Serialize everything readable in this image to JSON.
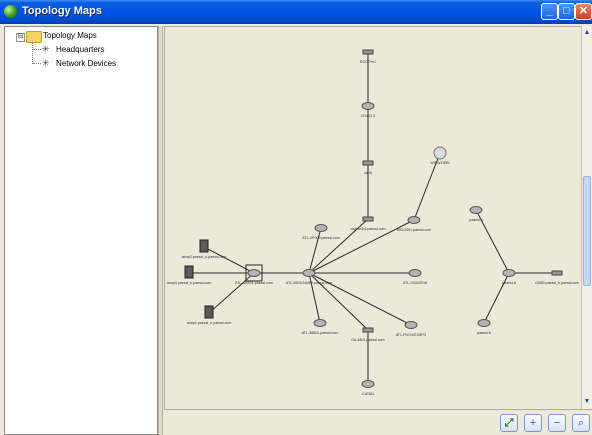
{
  "window": {
    "title": "Topology Maps"
  },
  "tree": {
    "expand_glyph": "⊟",
    "root_label": "Topology Maps",
    "items": [
      {
        "label": "Headquarters",
        "icon": "network-node-icon"
      },
      {
        "label": "Network Devices",
        "icon": "network-node-icon"
      }
    ]
  },
  "map": {
    "nodes": [
      {
        "id": "top",
        "label": "ROOT%C",
        "type": "hub"
      },
      {
        "id": "n2",
        "label": "CISCO 3",
        "type": "router"
      },
      {
        "id": "n3",
        "label": "cap5",
        "type": "hub"
      },
      {
        "id": "n4",
        "label": "wsmor3r3.paessl.com",
        "type": "hub"
      },
      {
        "id": "n5",
        "label": "EB103N1.paessl.com",
        "type": "router"
      },
      {
        "id": "globe",
        "label": "WWW.DEBI",
        "type": "globe"
      },
      {
        "id": "c1",
        "label": "ATL-VP009.paessl.com",
        "type": "router"
      },
      {
        "id": "center",
        "label": "ATL-6903/24MNI.paessl.com",
        "type": "router"
      },
      {
        "id": "sw",
        "label": "ATL-AX8S1.paessl.com",
        "type": "switch"
      },
      {
        "id": "l1",
        "label": "atrap2.paessl_n.paessl.com",
        "type": "server"
      },
      {
        "id": "l2",
        "label": "atrap3.paessl_n.paessl.com",
        "type": "server"
      },
      {
        "id": "l3",
        "label": "atrap1.paessl_n.paessl.com",
        "type": "server"
      },
      {
        "id": "r1",
        "label": "ATL-X04X/EH8",
        "type": "router"
      },
      {
        "id": "r2",
        "label": "ATL-PHOX/EX8PG",
        "type": "router"
      },
      {
        "id": "b1",
        "label": "ATL-38800.paessl.com",
        "type": "router"
      },
      {
        "id": "b2",
        "label": "DA-4801.paessl.com",
        "type": "hub"
      },
      {
        "id": "b3",
        "label": "CATAN",
        "type": "router"
      },
      {
        "id": "g1",
        "label": "paaesl-k",
        "type": "router"
      },
      {
        "id": "g2",
        "label": "paaesl-8",
        "type": "router"
      },
      {
        "id": "g3",
        "label": "paaesl-6",
        "type": "router"
      },
      {
        "id": "g4",
        "label": "c3550.paessl_n.paessl.com",
        "type": "hub"
      }
    ],
    "links": [
      [
        "top",
        "n2"
      ],
      [
        "n2",
        "n3"
      ],
      [
        "n3",
        "n4"
      ],
      [
        "n4",
        "center"
      ],
      [
        "globe",
        "n5"
      ],
      [
        "n5",
        "center"
      ],
      [
        "c1",
        "center"
      ],
      [
        "center",
        "sw"
      ],
      [
        "sw",
        "l1"
      ],
      [
        "sw",
        "l2"
      ],
      [
        "sw",
        "l3"
      ],
      [
        "center",
        "r1"
      ],
      [
        "center",
        "r2"
      ],
      [
        "center",
        "b1"
      ],
      [
        "center",
        "b2"
      ],
      [
        "b2",
        "b3"
      ],
      [
        "g1",
        "g2"
      ],
      [
        "g2",
        "g3"
      ],
      [
        "g2",
        "g4"
      ]
    ]
  },
  "zoom_buttons": [
    {
      "name": "zoom-fit-button",
      "glyph": "⤢"
    },
    {
      "name": "zoom-in-button",
      "glyph": "+"
    },
    {
      "name": "zoom-out-button",
      "glyph": "−"
    },
    {
      "name": "zoom-reset-button",
      "glyph": "⌕"
    }
  ],
  "colors": {
    "titlebar": "#0054e3",
    "close": "#cf3e1c",
    "canvas": "#ece9d8"
  }
}
